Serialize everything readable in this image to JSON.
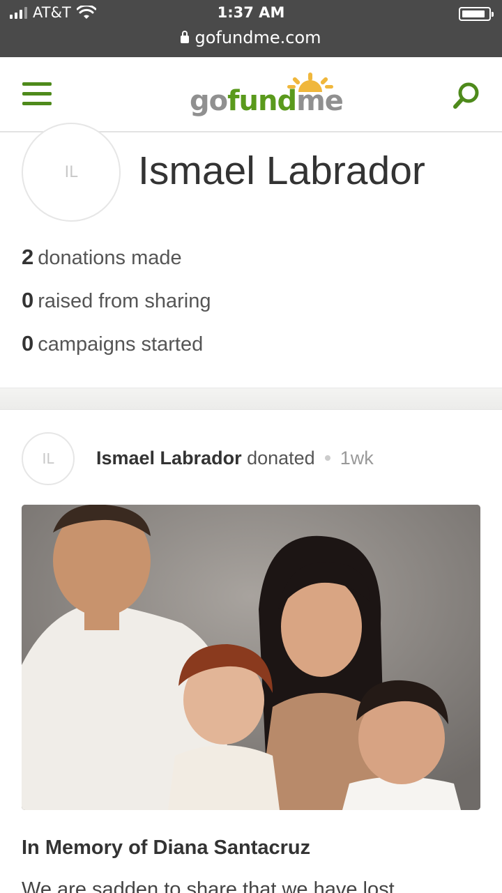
{
  "status_bar": {
    "carrier": "AT&T",
    "time": "1:37 AM",
    "url": "gofundme.com",
    "icons": [
      "signal-icon",
      "wifi-icon",
      "lock-icon",
      "battery-icon"
    ]
  },
  "navbar": {
    "logo": {
      "part1": "go",
      "part2": "fund",
      "part3": "me"
    },
    "icons": [
      "hamburger-menu-icon",
      "search-icon"
    ],
    "accent_color": "#5a9a1c"
  },
  "profile": {
    "initials": "IL",
    "name": "Ismael Labrador",
    "stats": [
      {
        "count": "2",
        "label": "donations made"
      },
      {
        "count": "0",
        "label": "raised from sharing"
      },
      {
        "count": "0",
        "label": "campaigns started"
      }
    ]
  },
  "feed_item": {
    "initials": "IL",
    "actor": "Ismael Labrador",
    "action": "donated",
    "time_ago": "1wk",
    "campaign_title": "In Memory of Diana Santacruz",
    "snippet": "We are sadden to share that we have lost"
  }
}
